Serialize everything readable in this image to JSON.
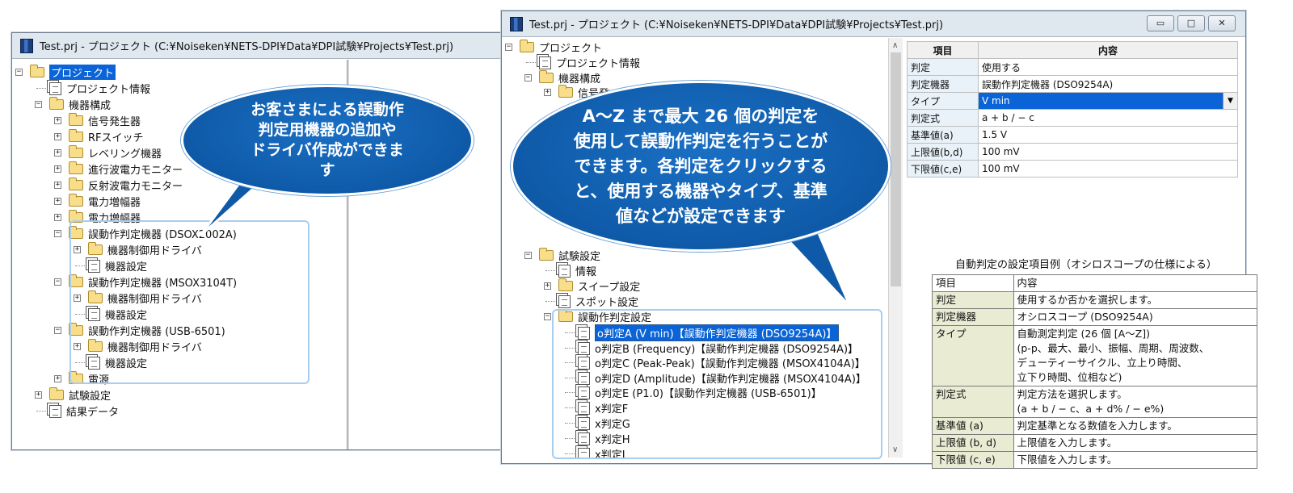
{
  "left_window": {
    "title": "Test.prj - プロジェクト (C:¥Noiseken¥NETS-DPI¥Data¥DPI試験¥Projects¥Test.prj)",
    "tree": [
      {
        "label": "プロジェクト",
        "icon": "folder-icon",
        "toggle": "−",
        "selected": true
      },
      {
        "label": "プロジェクト情報",
        "icon": "document-icon"
      },
      {
        "label": "機器構成",
        "icon": "folder-icon",
        "toggle": "−"
      },
      {
        "label": "信号発生器",
        "icon": "folder-icon",
        "toggle": "+"
      },
      {
        "label": "RFスイッチ",
        "icon": "folder-icon",
        "toggle": "+"
      },
      {
        "label": "レベリング機器",
        "icon": "folder-icon",
        "toggle": "+"
      },
      {
        "label": "進行波電力モニター",
        "icon": "folder-icon",
        "toggle": "+"
      },
      {
        "label": "反射波電力モニター",
        "icon": "folder-icon",
        "toggle": "+"
      },
      {
        "label": "電力増幅器",
        "icon": "folder-icon",
        "toggle": "+"
      },
      {
        "label": "電力増幅器",
        "icon": "folder-icon",
        "toggle": "+"
      },
      {
        "label": "誤動作判定機器 (DSOX2002A)",
        "icon": "folder-icon",
        "toggle": "−"
      },
      {
        "label": "機器制御用ドライバ",
        "icon": "folder-icon",
        "toggle": "+"
      },
      {
        "label": "機器設定",
        "icon": "document-icon"
      },
      {
        "label": "誤動作判定機器 (MSOX3104T)",
        "icon": "folder-icon",
        "toggle": "−"
      },
      {
        "label": "機器制御用ドライバ",
        "icon": "folder-icon",
        "toggle": "+"
      },
      {
        "label": "機器設定",
        "icon": "document-icon"
      },
      {
        "label": "誤動作判定機器 (USB-6501)",
        "icon": "folder-icon",
        "toggle": "−"
      },
      {
        "label": "機器制御用ドライバ",
        "icon": "folder-icon",
        "toggle": "+"
      },
      {
        "label": "機器設定",
        "icon": "document-icon"
      },
      {
        "label": "電源",
        "icon": "folder-icon",
        "toggle": "+"
      },
      {
        "label": "試験設定",
        "icon": "folder-icon",
        "toggle": "+"
      },
      {
        "label": "結果データ",
        "icon": "document-icon"
      }
    ]
  },
  "callout_left": {
    "lines": [
      "お客さまによる誤動作",
      "判定用機器の追加や",
      "ドライバ作成ができま",
      "す"
    ]
  },
  "right_window": {
    "title": "Test.prj - プロジェクト (C:¥Noiseken¥NETS-DPI¥Data¥DPI試験¥Projects¥Test.prj)",
    "buttons": {
      "minimize": "▭",
      "maximize": "□",
      "close": "✕"
    },
    "tree": [
      {
        "label": "プロジェクト",
        "icon": "folder-icon",
        "toggle": "−"
      },
      {
        "label": "プロジェクト情報",
        "icon": "document-icon"
      },
      {
        "label": "機器構成",
        "icon": "folder-icon",
        "toggle": "−"
      },
      {
        "label": "信号発",
        "icon": "folder-icon",
        "toggle": "+"
      },
      {
        "label": "試験設定",
        "icon": "folder-icon",
        "toggle": "−"
      },
      {
        "label": "情報",
        "icon": "document-icon"
      },
      {
        "label": "スイープ設定",
        "icon": "folder-icon",
        "toggle": "+"
      },
      {
        "label": "スポット設定",
        "icon": "document-icon"
      },
      {
        "label": "誤動作判定設定",
        "icon": "folder-icon",
        "toggle": "−"
      },
      {
        "label": "o判定A (V min)【誤動作判定機器 (DSO9254A)】",
        "icon": "document-icon",
        "selected": true
      },
      {
        "label": "o判定B (Frequency)【誤動作判定機器 (DSO9254A)】",
        "icon": "document-icon"
      },
      {
        "label": "o判定C (Peak-Peak)【誤動作判定機器 (MSOX4104A)】",
        "icon": "document-icon"
      },
      {
        "label": "o判定D (Amplitude)【誤動作判定機器 (MSOX4104A)】",
        "icon": "document-icon"
      },
      {
        "label": "o判定E (P1.0)【誤動作判定機器 (USB-6501)】",
        "icon": "document-icon"
      },
      {
        "label": "x判定F",
        "icon": "document-icon"
      },
      {
        "label": "x判定G",
        "icon": "document-icon"
      },
      {
        "label": "x判定H",
        "icon": "document-icon"
      },
      {
        "label": "x判定I",
        "icon": "document-icon"
      }
    ],
    "grid": {
      "headers": [
        "項目",
        "内容"
      ],
      "rows": [
        [
          "判定",
          "使用する"
        ],
        [
          "判定機器",
          "誤動作判定機器 (DSO9254A)"
        ],
        [
          "タイプ",
          "V min"
        ],
        [
          "判定式",
          "a + b / − c"
        ],
        [
          "基準値(a)",
          "1.5 V"
        ],
        [
          "上限値(b,d)",
          "100 mV"
        ],
        [
          "下限値(c,e)",
          "100 mV"
        ]
      ]
    }
  },
  "callout_center": {
    "lines": [
      "A～Z まで最大 26 個の判定を",
      "使用して誤動作判定を行うことが",
      "できます。各判定をクリックする",
      "と、使用する機器やタイプ、基準",
      "値などが設定できます"
    ]
  },
  "example_table": {
    "caption": "自動判定の設定項目例（オシロスコープの仕様による）",
    "rows": [
      {
        "key": "項目",
        "value": [
          "内容"
        ]
      },
      {
        "key": "判定",
        "value": [
          "使用するか否かを選択します。"
        ]
      },
      {
        "key": "判定機器",
        "value": [
          "オシロスコープ (DSO9254A)"
        ]
      },
      {
        "key": "タイプ",
        "value": [
          "自動測定判定 (26 個 [A～Z])",
          "(p-p、最大、最小、振幅、周期、周波数、",
          "デューティーサイクル、立上り時間、",
          "立下り時間、位相など)"
        ]
      },
      {
        "key": "判定式",
        "value": [
          "判定方法を選択します。",
          "(a + b / − c、a + d% / − e%)"
        ]
      },
      {
        "key": "基準値 (a)",
        "value": [
          "判定基準となる数値を入力します。"
        ]
      },
      {
        "key": "上限値 (b, d)",
        "value": [
          "上限値を入力します。"
        ]
      },
      {
        "key": "下限値 (c, e)",
        "value": [
          "下限値を入力します。"
        ]
      }
    ]
  }
}
